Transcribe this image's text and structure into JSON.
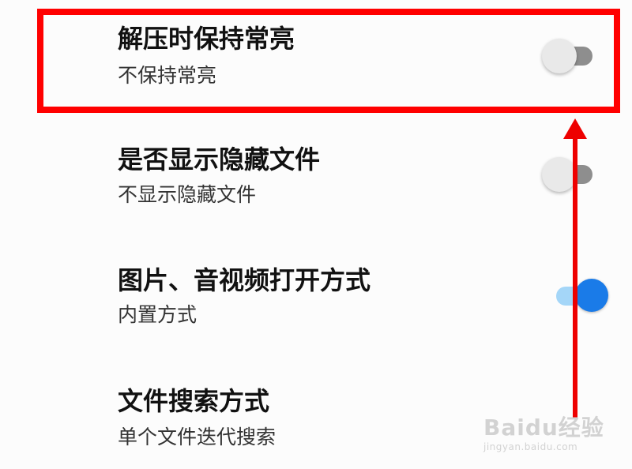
{
  "settings": [
    {
      "title": "解压时保持常亮",
      "subtitle": "不保持常亮",
      "toggle": "off"
    },
    {
      "title": "是否显示隐藏文件",
      "subtitle": "不显示隐藏文件",
      "toggle": "off"
    },
    {
      "title": "图片、音视频打开方式",
      "subtitle": "内置方式",
      "toggle": "on"
    },
    {
      "title": "文件搜索方式",
      "subtitle": "单个文件迭代搜索",
      "toggle": "none"
    }
  ],
  "annotation": {
    "highlight_color": "#ff0000",
    "arrow_color": "#ee0000"
  },
  "toggle_colors": {
    "off_track": "#8e8e8e",
    "off_knob": "#e9e9e9",
    "on_track": "#a4d6f8",
    "on_knob": "#1a7be8"
  },
  "watermark": {
    "main": "Baidu经验",
    "sub": "jingyan.baidu.com"
  }
}
